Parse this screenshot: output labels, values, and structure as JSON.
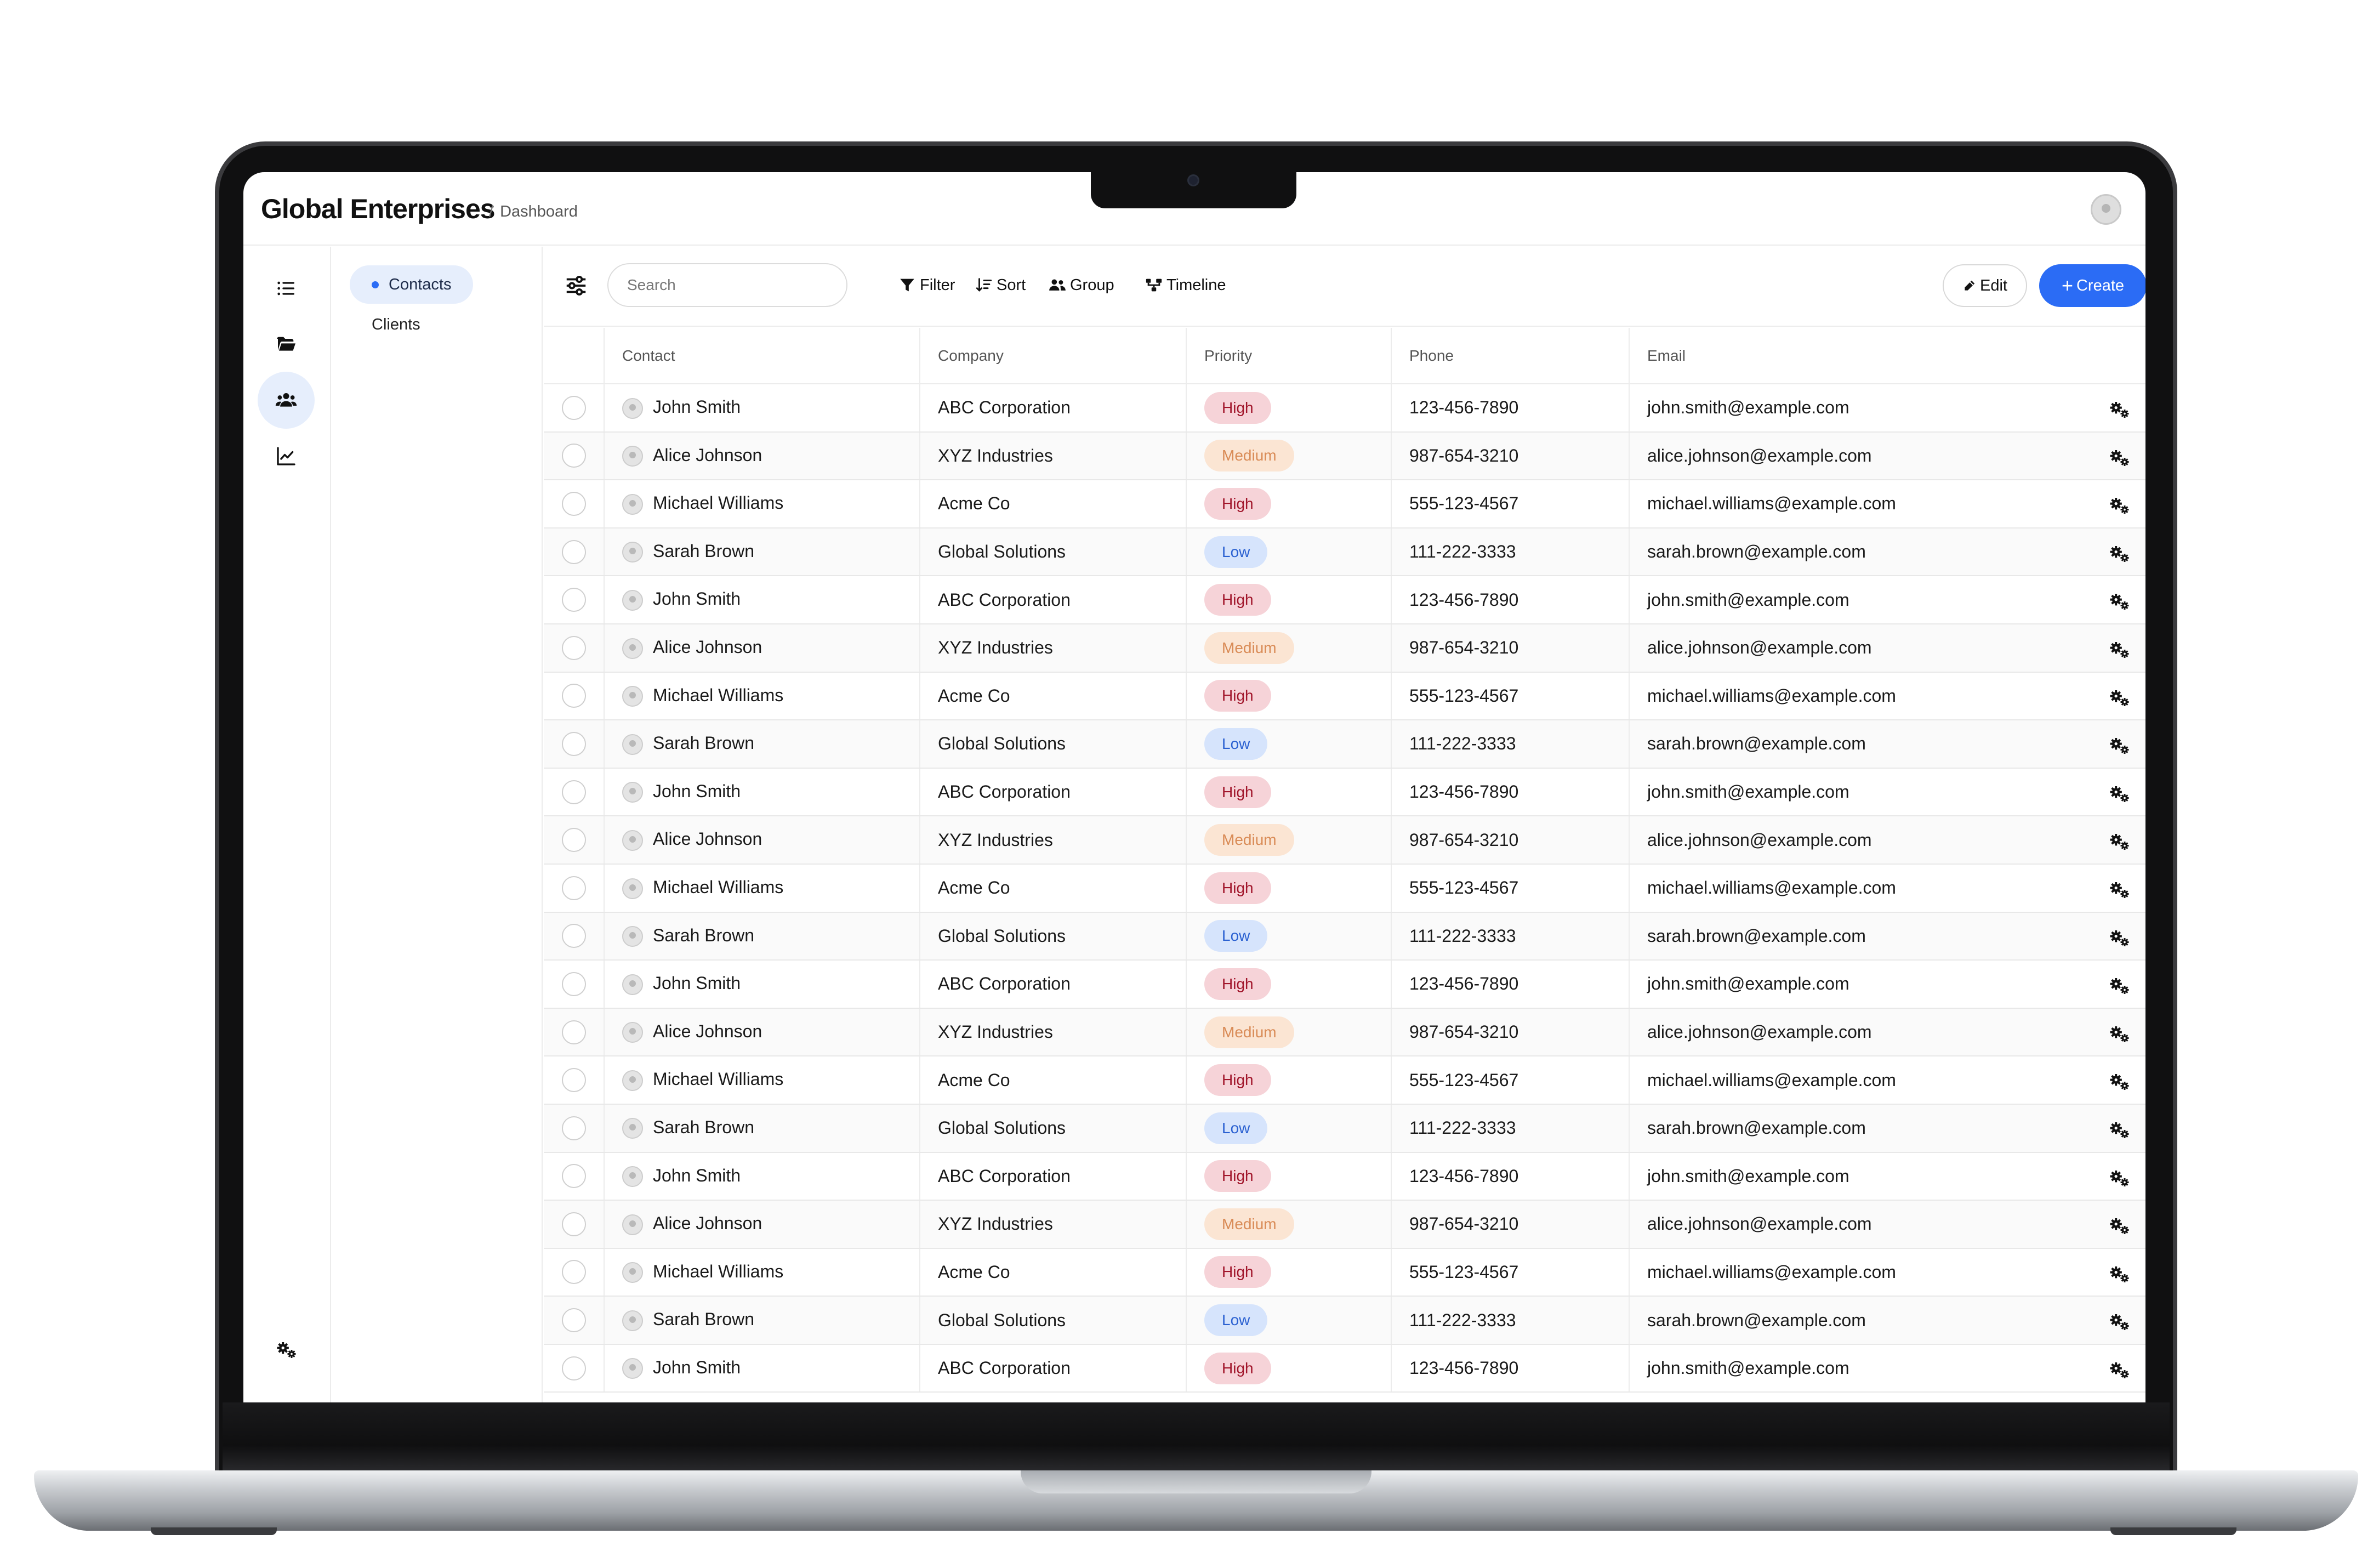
{
  "app": {
    "title": "Global Enterprises",
    "breadcrumb_separator": "/",
    "breadcrumb": "Dashboard"
  },
  "rail": {
    "icons": [
      "list-icon",
      "folder-open-icon",
      "users-icon",
      "line-chart-icon",
      "gears-icon"
    ],
    "active": "users-icon"
  },
  "sidebar": {
    "items": [
      {
        "label": "Contacts",
        "active": true
      },
      {
        "label": "Clients",
        "active": false
      }
    ]
  },
  "toolbar": {
    "search_placeholder": "Search",
    "filter_label": "Filter",
    "sort_label": "Sort",
    "group_label": "Group",
    "timeline_label": "Timeline",
    "edit_label": "Edit",
    "create_label": "Create"
  },
  "colors": {
    "accent": "#2b6cf5",
    "high": "#a1162b",
    "medium": "#d98b56",
    "low": "#2b61d1"
  },
  "table": {
    "columns": [
      "Contact",
      "Company",
      "Priority",
      "Phone",
      "Email"
    ],
    "rows": [
      {
        "contact": "John Smith",
        "company": "ABC Corporation",
        "priority": "High",
        "phone": "123-456-7890",
        "email": "john.smith@example.com"
      },
      {
        "contact": "Alice Johnson",
        "company": "XYZ Industries",
        "priority": "Medium",
        "phone": "987-654-3210",
        "email": "alice.johnson@example.com"
      },
      {
        "contact": "Michael Williams",
        "company": "Acme Co",
        "priority": "High",
        "phone": "555-123-4567",
        "email": "michael.williams@example.com"
      },
      {
        "contact": "Sarah Brown",
        "company": "Global Solutions",
        "priority": "Low",
        "phone": "111-222-3333",
        "email": "sarah.brown@example.com"
      },
      {
        "contact": "John Smith",
        "company": "ABC Corporation",
        "priority": "High",
        "phone": "123-456-7890",
        "email": "john.smith@example.com"
      },
      {
        "contact": "Alice Johnson",
        "company": "XYZ Industries",
        "priority": "Medium",
        "phone": "987-654-3210",
        "email": "alice.johnson@example.com"
      },
      {
        "contact": "Michael Williams",
        "company": "Acme Co",
        "priority": "High",
        "phone": "555-123-4567",
        "email": "michael.williams@example.com"
      },
      {
        "contact": "Sarah Brown",
        "company": "Global Solutions",
        "priority": "Low",
        "phone": "111-222-3333",
        "email": "sarah.brown@example.com"
      },
      {
        "contact": "John Smith",
        "company": "ABC Corporation",
        "priority": "High",
        "phone": "123-456-7890",
        "email": "john.smith@example.com"
      },
      {
        "contact": "Alice Johnson",
        "company": "XYZ Industries",
        "priority": "Medium",
        "phone": "987-654-3210",
        "email": "alice.johnson@example.com"
      },
      {
        "contact": "Michael Williams",
        "company": "Acme Co",
        "priority": "High",
        "phone": "555-123-4567",
        "email": "michael.williams@example.com"
      },
      {
        "contact": "Sarah Brown",
        "company": "Global Solutions",
        "priority": "Low",
        "phone": "111-222-3333",
        "email": "sarah.brown@example.com"
      },
      {
        "contact": "John Smith",
        "company": "ABC Corporation",
        "priority": "High",
        "phone": "123-456-7890",
        "email": "john.smith@example.com"
      },
      {
        "contact": "Alice Johnson",
        "company": "XYZ Industries",
        "priority": "Medium",
        "phone": "987-654-3210",
        "email": "alice.johnson@example.com"
      },
      {
        "contact": "Michael Williams",
        "company": "Acme Co",
        "priority": "High",
        "phone": "555-123-4567",
        "email": "michael.williams@example.com"
      },
      {
        "contact": "Sarah Brown",
        "company": "Global Solutions",
        "priority": "Low",
        "phone": "111-222-3333",
        "email": "sarah.brown@example.com"
      },
      {
        "contact": "John Smith",
        "company": "ABC Corporation",
        "priority": "High",
        "phone": "123-456-7890",
        "email": "john.smith@example.com"
      },
      {
        "contact": "Alice Johnson",
        "company": "XYZ Industries",
        "priority": "Medium",
        "phone": "987-654-3210",
        "email": "alice.johnson@example.com"
      },
      {
        "contact": "Michael Williams",
        "company": "Acme Co",
        "priority": "High",
        "phone": "555-123-4567",
        "email": "michael.williams@example.com"
      },
      {
        "contact": "Sarah Brown",
        "company": "Global Solutions",
        "priority": "Low",
        "phone": "111-222-3333",
        "email": "sarah.brown@example.com"
      },
      {
        "contact": "John Smith",
        "company": "ABC Corporation",
        "priority": "High",
        "phone": "123-456-7890",
        "email": "john.smith@example.com"
      }
    ]
  }
}
